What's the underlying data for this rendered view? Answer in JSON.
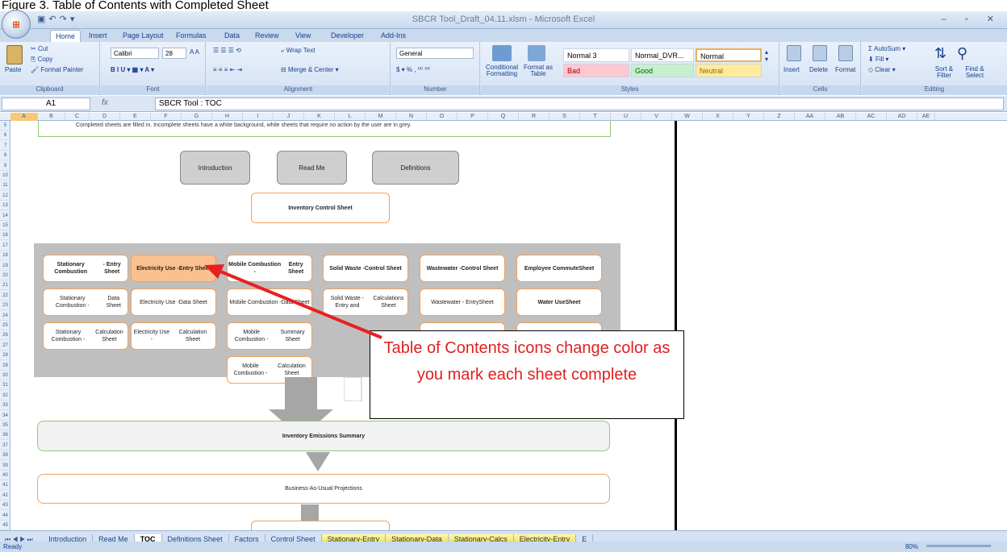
{
  "caption": "Figure 3. Table of Contents with Completed Sheet",
  "window": {
    "title": "SBCR Tool_Draft_04.11.xlsm - Microsoft Excel",
    "office_button": "Office",
    "qat": [
      "save-icon",
      "undo-icon",
      "redo-icon"
    ],
    "controls": "– ▫ ✕"
  },
  "tabs": [
    "Home",
    "Insert",
    "Page Layout",
    "Formulas",
    "Data",
    "Review",
    "View",
    "Developer",
    "Add-Ins"
  ],
  "ribbon": {
    "clipboard": {
      "paste": "Paste",
      "cut": "Cut",
      "copy": "Copy",
      "format_painter": "Format Painter",
      "label": "Clipboard"
    },
    "font": {
      "name": "Calibri",
      "size": "28",
      "label": "Font"
    },
    "alignment": {
      "wrap": "Wrap Text",
      "merge": "Merge & Center",
      "label": "Alignment"
    },
    "number": {
      "format": "General",
      "label": "Number"
    },
    "styles": {
      "conditional": "Conditional Formatting",
      "format_table": "Format as Table",
      "cells": [
        "Normal 3",
        "Normal_DVR...",
        "Normal",
        "Bad",
        "Good",
        "Neutral"
      ],
      "label": "Styles"
    },
    "cells": {
      "insert": "Insert",
      "delete": "Delete",
      "format": "Format",
      "label": "Cells"
    },
    "editing": {
      "autosum": "AutoSum",
      "fill": "Fill",
      "clear": "Clear",
      "sort": "Sort & Filter",
      "find": "Find & Select",
      "label": "Editing"
    }
  },
  "formula_bar": {
    "cell": "A1",
    "fx": "fx",
    "content": "SBCR Tool : TOC"
  },
  "columns": [
    "A",
    "B",
    "C",
    "D",
    "E",
    "F",
    "G",
    "H",
    "I",
    "J",
    "K",
    "L",
    "M",
    "N",
    "O",
    "P",
    "Q",
    "R",
    "S",
    "T",
    "U",
    "V",
    "W",
    "X",
    "Y",
    "Z",
    "AA",
    "AB",
    "AC",
    "AD",
    "AE"
  ],
  "rows": [
    "5",
    "6",
    "7",
    "8",
    "9",
    "10",
    "11",
    "12",
    "13",
    "14",
    "15",
    "16",
    "17",
    "18",
    "19",
    "20",
    "21",
    "22",
    "23",
    "24",
    "25",
    "26",
    "27",
    "28",
    "29",
    "30",
    "31",
    "32",
    "33",
    "34",
    "35",
    "36",
    "37",
    "38",
    "39",
    "40",
    "41",
    "42",
    "43",
    "44",
    "45"
  ],
  "sheet": {
    "top_text": "Completed sheets are filled in. Incomplete sheets have a white background, while sheets that require no action by the user are in grey.",
    "nav_buttons": [
      "Introduction",
      "Read Me",
      "Definitions"
    ],
    "inventory_control": "Inventory Control Sheet",
    "grid_boxes": [
      {
        "line1": "Stationary Combustion",
        "line2": "- Entry Sheet",
        "bold": true,
        "fill": "white"
      },
      {
        "line1": "Electricity Use -",
        "line2": "Entry Sheet",
        "bold": true,
        "fill": "orange"
      },
      {
        "line1": "Mobile Combustion -",
        "line2": "Entry Sheet",
        "bold": true,
        "fill": "white"
      },
      {
        "line1": "Solid Waste -",
        "line2": "Control Sheet",
        "bold": true,
        "fill": "white"
      },
      {
        "line1": "Wastewater -",
        "line2": "Control Sheet",
        "bold": true,
        "fill": "white"
      },
      {
        "line1": "Employee Commute",
        "line2": "Sheet",
        "bold": true,
        "fill": "white"
      },
      {
        "line1": "Stationary Combustion -",
        "line2": "Data Sheet",
        "bold": false,
        "fill": "white"
      },
      {
        "line1": "Electricity Use -",
        "line2": "Data Sheet",
        "bold": false,
        "fill": "white"
      },
      {
        "line1": "Mobile Combustion -",
        "line2": "Data Sheet",
        "bold": false,
        "fill": "white"
      },
      {
        "line1": "Solid Waste - Entry and",
        "line2": "Calculations Sheet",
        "bold": false,
        "fill": "white"
      },
      {
        "line1": "Wastewater - Entry",
        "line2": "Sheet",
        "bold": false,
        "fill": "white"
      },
      {
        "line1": "Water Use",
        "line2": "Sheet",
        "bold": true,
        "fill": "white"
      },
      {
        "line1": "Stationary Combustion -",
        "line2": "Calculation Sheet",
        "bold": false,
        "fill": "white"
      },
      {
        "line1": "Electricity Use -",
        "line2": "Calculation Sheet",
        "bold": false,
        "fill": "white"
      },
      {
        "line1": "Mobile Combustion -",
        "line2": "Summary Sheet",
        "bold": false,
        "fill": "white"
      },
      {
        "line1": "Mobile Combustion -",
        "line2": "Calculation Sheet",
        "bold": false,
        "fill": "white"
      }
    ],
    "summary": "Inventory Emissions Summary",
    "projections": "Business-As-Usual Projections",
    "callout": "Table of Contents icons change color as you mark each sheet complete"
  },
  "sheet_tabs": [
    "Introduction",
    "Read Me",
    "TOC",
    "Definitions Sheet",
    "Factors",
    "Control Sheet",
    "Stationary-Entry",
    "Stationary-Data",
    "Stationary-Calcs",
    "Electricity-Entry",
    "E"
  ],
  "status": {
    "ready": "Ready",
    "zoom": "80%"
  },
  "colors": {
    "orange": "#f2a05a",
    "orange_fill": "#fbc08f",
    "green": "#8fc873",
    "callout_text": "#e02020",
    "arrow": "#e82020"
  }
}
